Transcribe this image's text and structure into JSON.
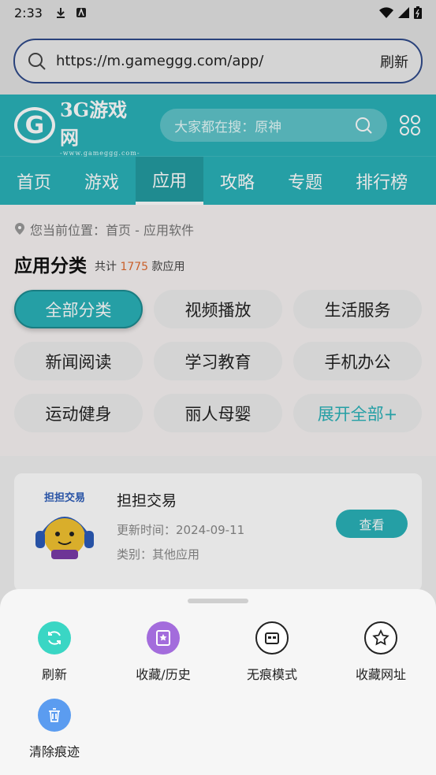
{
  "status_bar": {
    "time": "2:33"
  },
  "url_bar": {
    "url": "https://m.gameggg.com/app/",
    "refresh_label": "刷新"
  },
  "site": {
    "logo_text": "3G游戏网",
    "logo_sub": "-www.gameggg.com-",
    "search_placeholder": "大家都在搜：原神",
    "nav_tabs": [
      {
        "label": "首页",
        "active": false
      },
      {
        "label": "游戏",
        "active": false
      },
      {
        "label": "应用",
        "active": true
      },
      {
        "label": "攻略",
        "active": false
      },
      {
        "label": "专题",
        "active": false
      },
      {
        "label": "排行榜",
        "active": false
      }
    ],
    "breadcrumb": "您当前位置：首页 - 应用软件",
    "category_title": "应用分类",
    "count_prefix": "共计",
    "count_value": "1775",
    "count_suffix": "款应用",
    "categories": [
      "全部分类",
      "视频播放",
      "生活服务",
      "新闻阅读",
      "学习教育",
      "手机办公",
      "运动健身",
      "丽人母婴",
      "展开全部+"
    ],
    "app_card": {
      "icon_label": "担担交易",
      "name": "担担交易",
      "updated": "更新时间：2024-09-11",
      "category": "类别：其他应用",
      "button": "查看"
    }
  },
  "sheet": {
    "items": [
      {
        "label": "刷新",
        "icon": "refresh-icon",
        "color": "#3ad6c4"
      },
      {
        "label": "收藏/历史",
        "icon": "bookmark-star-icon",
        "color": "#a36cdc"
      },
      {
        "label": "无痕模式",
        "icon": "incognito-mask-icon",
        "color": "#ffffff"
      },
      {
        "label": "收藏网址",
        "icon": "star-outline-icon",
        "color": "#ffffff"
      },
      {
        "label": "清除痕迹",
        "icon": "trash-icon",
        "color": "#5b9cf0"
      }
    ]
  },
  "colors": {
    "brand": "#2ab2b8",
    "url_border": "#2f4a8a",
    "count_accent": "#e06b30"
  }
}
